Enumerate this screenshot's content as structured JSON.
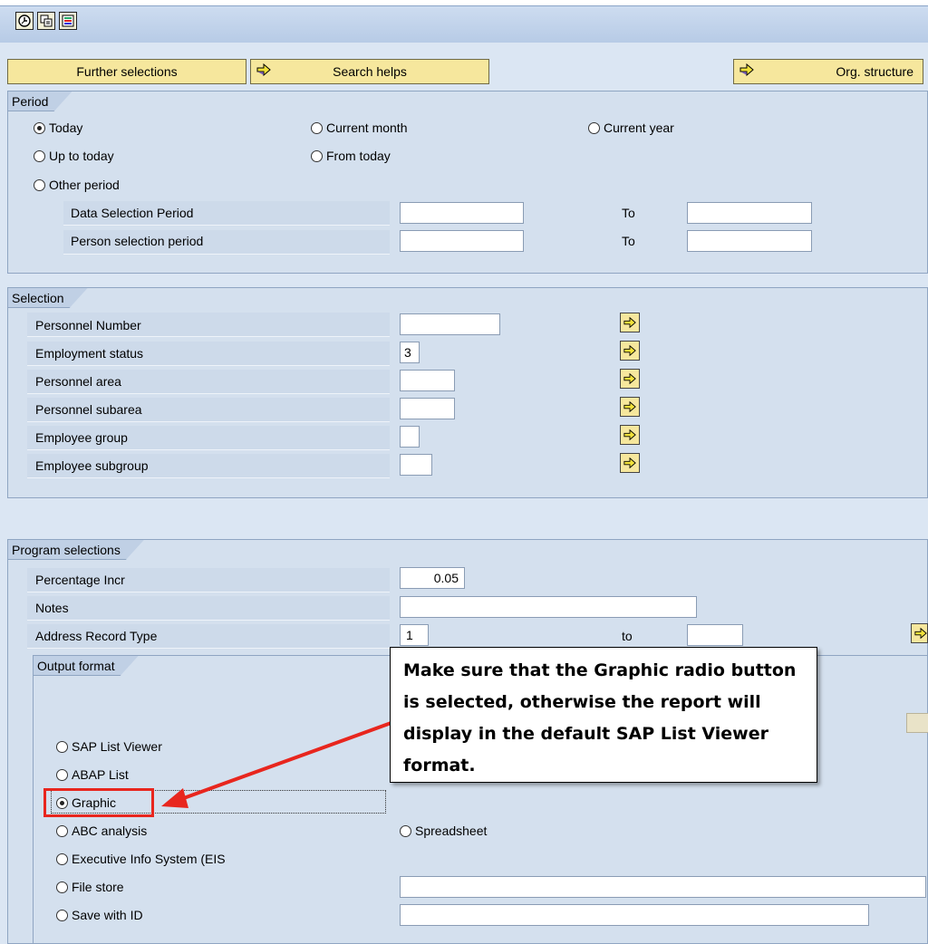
{
  "toolbar": {
    "icons": [
      "execute-icon",
      "copy-variant-icon",
      "selection-options-icon"
    ]
  },
  "buttons": {
    "further_selections": "Further selections",
    "search_helps": "Search helps",
    "org_structure": "Org. structure"
  },
  "period": {
    "title": "Period",
    "radios": {
      "today": "Today",
      "current_month": "Current month",
      "current_year": "Current year",
      "up_to_today": "Up to today",
      "from_today": "From today",
      "other_period": "Other period"
    },
    "selected": "today",
    "data_selection_label": "Data Selection Period",
    "person_selection_label": "Person selection period",
    "to_label": "To"
  },
  "selection": {
    "title": "Selection",
    "rows": [
      {
        "label": "Personnel Number",
        "value": ""
      },
      {
        "label": "Employment status",
        "value": "3"
      },
      {
        "label": "Personnel area",
        "value": ""
      },
      {
        "label": "Personnel subarea",
        "value": ""
      },
      {
        "label": "Employee group",
        "value": ""
      },
      {
        "label": "Employee subgroup",
        "value": ""
      }
    ]
  },
  "program": {
    "title": "Program selections",
    "percentage_label": "Percentage Incr",
    "percentage_value": "0.05",
    "notes_label": "Notes",
    "notes_value": "",
    "address_label": "Address Record Type",
    "address_from": "1",
    "to_label": "to",
    "address_to": ""
  },
  "output": {
    "title": "Output format",
    "options": {
      "sap_list_viewer": "SAP List Viewer",
      "abap_list": "ABAP List",
      "graphic": "Graphic",
      "abc_analysis": "ABC analysis",
      "spreadsheet": "Spreadsheet",
      "eis": "Executive Info System (EIS",
      "file_store": "File store",
      "save_with_id": "Save with ID"
    },
    "selected": "graphic"
  },
  "callout": {
    "text": "Make sure that the Graphic radio button is selected, otherwise the report will display in the default SAP List Viewer format."
  },
  "colors": {
    "highlight": "#e8261e",
    "panel": "#dbe6f3",
    "button": "#f6e79d"
  }
}
